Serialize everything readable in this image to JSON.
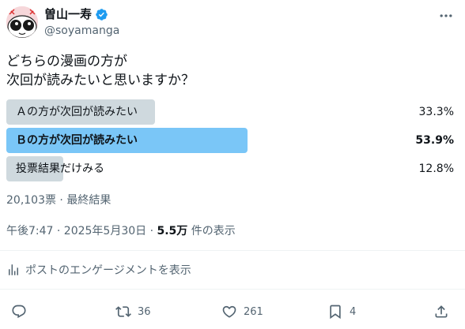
{
  "author": {
    "name": "曽山一寿",
    "handle": "@soyamanga"
  },
  "tweet": {
    "line1": "どちらの漫画の方が",
    "line2": "次回が読みたいと思いますか？"
  },
  "poll": {
    "options": [
      {
        "label": "Ａの方が次回が読みたい",
        "percent_text": "33.3%",
        "percent": 33.3
      },
      {
        "label": "Ｂの方が次回が読みたい",
        "percent_text": "53.9%",
        "percent": 53.9
      },
      {
        "label": "投票結果だけみる",
        "percent_text": "12.8%",
        "percent": 12.8
      }
    ],
    "summary": "20,103票 · 最終結果"
  },
  "timestamp": {
    "prefix": "午後7:47 · 2025年5月30日 · ",
    "views": "5.5万",
    "suffix": " 件の表示"
  },
  "engagement_link": "ポストのエンゲージメントを表示",
  "actions": {
    "reply_count": "",
    "retweet_count": "36",
    "like_count": "261",
    "bookmark_count": "4"
  },
  "colors": {
    "winner_bar": "#7ac6f7",
    "other_bar": "#cfd9de",
    "verified": "#1d9bf0",
    "muted_text": "#536471"
  }
}
